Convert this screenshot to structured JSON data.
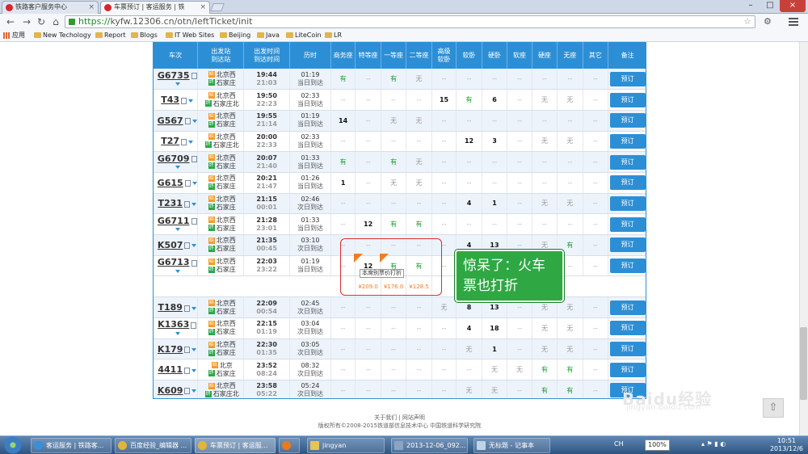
{
  "browser": {
    "tabs": [
      {
        "title": "铁路客户服务中心"
      },
      {
        "title": "车票预订 | 客运服务 | 铁"
      }
    ],
    "url": {
      "scheme": "https://",
      "rest": "kyfw.12306.cn/otn/leftTicket/init"
    },
    "bookmarks": [
      "应用",
      "New Techology",
      "Report",
      "Blogs",
      "IT Web Sites",
      "Beijing",
      "Java",
      "LiteCoin",
      "LR"
    ]
  },
  "table": {
    "headers": [
      "车次",
      "出发站\n到达站",
      "出发时间\n到达时间",
      "历时",
      "商务座",
      "特等座",
      "一等座",
      "二等座",
      "高级\n软卧",
      "软卧",
      "硬卧",
      "软座",
      "硬座",
      "无座",
      "其它",
      "备注"
    ],
    "rows": [
      {
        "train": "G6735",
        "from": "北京西",
        "to": "石家庄",
        "dep": "19:44",
        "arr": "21:03",
        "dur": "01:19",
        "day": "当日到达",
        "seats": [
          "有",
          "--",
          "有",
          "无",
          "--",
          "--",
          "--",
          "--",
          "--",
          "--",
          "--"
        ]
      },
      {
        "train": "T43",
        "from": "北京西",
        "to": "石家庄北",
        "dep": "19:50",
        "arr": "22:23",
        "dur": "02:33",
        "day": "当日到达",
        "seats": [
          "--",
          "--",
          "--",
          "--",
          "15",
          "有",
          "6",
          "--",
          "无",
          "无",
          "--"
        ]
      },
      {
        "train": "G567",
        "from": "北京西",
        "to": "石家庄",
        "dep": "19:55",
        "arr": "21:14",
        "dur": "01:19",
        "day": "当日到达",
        "seats": [
          "14",
          "--",
          "无",
          "无",
          "--",
          "--",
          "--",
          "--",
          "--",
          "--",
          "--"
        ]
      },
      {
        "train": "T27",
        "from": "北京西",
        "to": "石家庄北",
        "dep": "20:00",
        "arr": "22:33",
        "dur": "02:33",
        "day": "当日到达",
        "seats": [
          "--",
          "--",
          "--",
          "--",
          "--",
          "12",
          "3",
          "--",
          "无",
          "无",
          "--"
        ]
      },
      {
        "train": "G6709",
        "from": "北京西",
        "to": "石家庄",
        "dep": "20:07",
        "arr": "21:40",
        "dur": "01:33",
        "day": "当日到达",
        "seats": [
          "有",
          "--",
          "有",
          "无",
          "--",
          "--",
          "--",
          "--",
          "--",
          "--",
          "--"
        ]
      },
      {
        "train": "G615",
        "from": "北京西",
        "to": "石家庄",
        "dep": "20:21",
        "arr": "21:47",
        "dur": "01:26",
        "day": "当日到达",
        "seats": [
          "1",
          "--",
          "无",
          "无",
          "--",
          "--",
          "--",
          "--",
          "--",
          "--",
          "--"
        ]
      },
      {
        "train": "T231",
        "from": "北京西",
        "to": "石家庄",
        "dep": "21:15",
        "arr": "00:01",
        "dur": "02:46",
        "day": "次日到达",
        "seats": [
          "--",
          "--",
          "--",
          "--",
          "--",
          "4",
          "1",
          "--",
          "无",
          "无",
          "--"
        ]
      },
      {
        "train": "G6711",
        "from": "北京西",
        "to": "石家庄",
        "dep": "21:28",
        "arr": "23:01",
        "dur": "01:33",
        "day": "当日到达",
        "seats": [
          "--",
          "12",
          "有",
          "有",
          "--",
          "--",
          "--",
          "--",
          "--",
          "--",
          "--"
        ]
      },
      {
        "train": "K507",
        "from": "北京西",
        "to": "石家庄",
        "dep": "21:35",
        "arr": "00:45",
        "dur": "03:10",
        "day": "次日到达",
        "seats": [
          "--",
          "--",
          "--",
          "--",
          "--",
          "4",
          "13",
          "--",
          "无",
          "有",
          "--"
        ]
      },
      {
        "train": "G6713",
        "from": "北京西",
        "to": "石家庄",
        "dep": "22:03",
        "arr": "23:22",
        "dur": "01:19",
        "day": "当日到达",
        "seats": [
          "--",
          "12",
          "有",
          "有",
          "--",
          "--",
          "--",
          "--",
          "--",
          "--",
          "--"
        ],
        "prices": [
          "¥209.0",
          "¥176.0",
          "¥128.5"
        ],
        "discount_tip": "本席别票价打折"
      },
      {
        "train": "T189",
        "from": "北京西",
        "to": "石家庄",
        "dep": "22:09",
        "arr": "00:54",
        "dur": "02:45",
        "day": "次日到达",
        "seats": [
          "--",
          "--",
          "--",
          "--",
          "无",
          "8",
          "13",
          "--",
          "无",
          "无",
          "--"
        ]
      },
      {
        "train": "K1363",
        "from": "北京西",
        "to": "石家庄",
        "dep": "22:15",
        "arr": "01:19",
        "dur": "03:04",
        "day": "次日到达",
        "seats": [
          "--",
          "--",
          "--",
          "--",
          "--",
          "4",
          "18",
          "--",
          "无",
          "无",
          "--"
        ]
      },
      {
        "train": "K179",
        "from": "北京西",
        "to": "石家庄",
        "dep": "22:30",
        "arr": "01:35",
        "dur": "03:05",
        "day": "次日到达",
        "seats": [
          "--",
          "--",
          "--",
          "--",
          "--",
          "无",
          "1",
          "--",
          "无",
          "无",
          "--"
        ]
      },
      {
        "train": "4411",
        "from": "北京",
        "to": "石家庄",
        "dep": "23:52",
        "arr": "08:24",
        "dur": "08:32",
        "day": "次日到达",
        "seats": [
          "--",
          "--",
          "--",
          "--",
          "--",
          "--",
          "无",
          "无",
          "有",
          "有",
          "--"
        ]
      },
      {
        "train": "K609",
        "from": "北京西",
        "to": "石家庄北",
        "dep": "23:58",
        "arr": "05:22",
        "dur": "05:24",
        "day": "次日到达",
        "seats": [
          "--",
          "--",
          "--",
          "--",
          "--",
          "无",
          "无",
          "--",
          "有",
          "有",
          "--"
        ]
      }
    ],
    "book_label": "预订"
  },
  "annotation": {
    "note": "惊呆了：火车票也打折"
  },
  "footer": {
    "links": "关于我们 | 网站声明",
    "copyright": "版权所有©2008-2015铁道部信息技术中心  中国铁道科学研究院"
  },
  "watermark": {
    "brand": "Baidu经验",
    "sub": "jingyan.baidu.com"
  },
  "taskbar": {
    "items": [
      "客运服务 | 铁路客...",
      "百度经验_编辑器 ...",
      "车票预订 | 客运服...",
      "",
      "jingyan",
      "2013-12-06_092...",
      "无标题 - 记事本"
    ],
    "zoom": "100%",
    "lang": "CH",
    "time": "10:51",
    "date": "2013/12/6"
  },
  "colors": {
    "accent": "#2c8fd6",
    "available": "#1a9e2b",
    "price": "#f27b27",
    "note_bg": "#2fa843",
    "highlight": "#e12a2a"
  }
}
